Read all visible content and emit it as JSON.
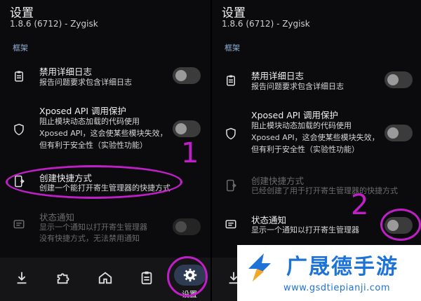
{
  "left": {
    "title": "设置",
    "subtitle": "1.8.6 (6712) - Zygisk",
    "section": "框架",
    "rows": [
      {
        "title": "禁用详细日志",
        "desc": "报告问题要求包含详细日志"
      },
      {
        "title": "Xposed API 调用保护",
        "desc1": "阻止模块动态加载的代码使用",
        "desc2": "Xposed API，这会使某些模块失效，",
        "desc3": "但有利于安全性（实验性功能）"
      },
      {
        "title": "创建快捷方式",
        "desc": "创建一个能打开寄生管理器的快捷方式"
      },
      {
        "title": "状态通知",
        "desc1": "显示一个通知以打开寄生管理器",
        "desc2": "没有快捷方式，无法禁用通知"
      }
    ],
    "nav_active_label": "设置",
    "marker": "1"
  },
  "right": {
    "title": "设置",
    "subtitle": "1.8.6 (6712) - Zygisk",
    "section": "框架",
    "rows": [
      {
        "title": "禁用详细日志",
        "desc": "报告问题要求包含详细日志"
      },
      {
        "title": "Xposed API 调用保护",
        "desc1": "阻止模块动态加载的代码使用",
        "desc2": "Xposed API，这会使某些模块失效，",
        "desc3": "但有利于安全性（实验性功能）"
      },
      {
        "title": "创建快捷方式",
        "desc": "已经创建了用于打开寄生管理器的快捷方式"
      },
      {
        "title": "状态通知",
        "desc": "显示一个通知以打开寄生管理器"
      }
    ],
    "marker": "2"
  },
  "watermark": {
    "title": "广晟德手游",
    "url": "www.gsdtiepianji.com"
  },
  "colors": {
    "annotation": "#c01fc8",
    "watermark": "#1e73d8"
  },
  "icons": [
    "clipboard-icon",
    "shield-icon",
    "shortcut-icon",
    "notification-icon",
    "download-icon",
    "puzzle-icon",
    "home-icon",
    "gear-icon"
  ]
}
